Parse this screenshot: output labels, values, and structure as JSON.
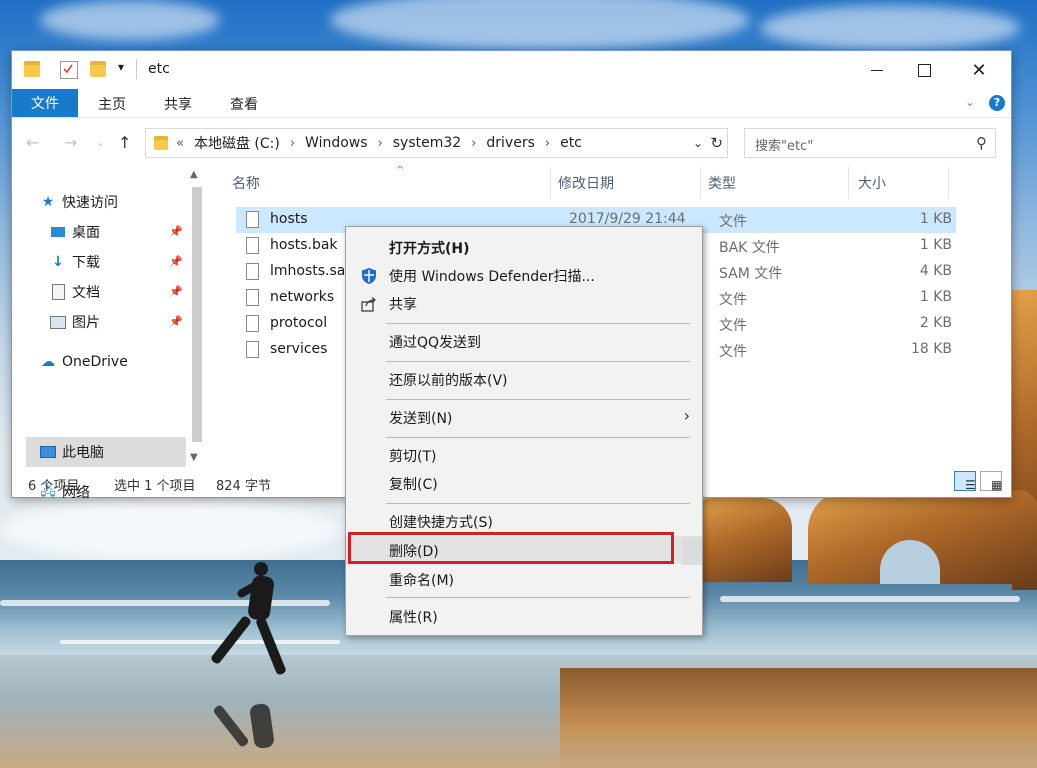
{
  "window": {
    "title": "etc",
    "qat_dropdown": "▾"
  },
  "ribbon": {
    "tabs": [
      {
        "label": "文件"
      },
      {
        "label": "主页"
      },
      {
        "label": "共享"
      },
      {
        "label": "查看"
      }
    ],
    "help": "?"
  },
  "address": {
    "path": [
      "本地磁盘 (C:)",
      "Windows",
      "system32",
      "drivers",
      "etc"
    ],
    "prefix": "«",
    "separator": "›"
  },
  "search": {
    "placeholder": "搜索\"etc\""
  },
  "nav": {
    "items": [
      {
        "label": "快速访问",
        "icon": "star-icon",
        "pinned": false
      },
      {
        "label": "桌面",
        "icon": "desktop-icon",
        "pinned": true
      },
      {
        "label": "下载",
        "icon": "download-icon",
        "pinned": true
      },
      {
        "label": "文档",
        "icon": "document-icon",
        "pinned": true
      },
      {
        "label": "图片",
        "icon": "picture-icon",
        "pinned": true
      },
      {
        "label": "OneDrive",
        "icon": "cloud-icon",
        "pinned": false
      },
      {
        "label": "此电脑",
        "icon": "computer-icon",
        "pinned": false,
        "selected": true
      },
      {
        "label": "网络",
        "icon": "network-icon",
        "pinned": false
      }
    ]
  },
  "columns": {
    "name": "名称",
    "date": "修改日期",
    "type": "类型",
    "size": "大小"
  },
  "files": [
    {
      "name": "hosts",
      "date": "2017/9/29 21:44",
      "type": "文件",
      "size": "1 KB",
      "selected": true
    },
    {
      "name": "hosts.bak",
      "date": "",
      "type": "BAK 文件",
      "size": "1 KB"
    },
    {
      "name": "lmhosts.sam",
      "date": "",
      "type": "SAM 文件",
      "size": "4 KB"
    },
    {
      "name": "networks",
      "date": "",
      "type": "文件",
      "size": "1 KB"
    },
    {
      "name": "protocol",
      "date": "",
      "type": "文件",
      "size": "2 KB"
    },
    {
      "name": "services",
      "date": "",
      "type": "文件",
      "size": "18 KB"
    }
  ],
  "status": {
    "count": "6 个项目",
    "selection": "选中 1 个项目",
    "size": "824 字节"
  },
  "context_menu": {
    "items": [
      {
        "label": "打开方式(H)",
        "bold": true
      },
      {
        "label": "使用 Windows Defender扫描...",
        "icon": "shield-icon"
      },
      {
        "label": "共享",
        "icon": "share-icon"
      },
      {
        "label": "通过QQ发送到"
      },
      {
        "label": "还原以前的版本(V)"
      },
      {
        "label": "发送到(N)",
        "submenu": true
      },
      {
        "label": "剪切(T)"
      },
      {
        "label": "复制(C)"
      },
      {
        "label": "创建快捷方式(S)"
      },
      {
        "label": "删除(D)",
        "highlighted": true
      },
      {
        "label": "重命名(M)"
      },
      {
        "label": "属性(R)"
      }
    ],
    "highlight_color": "#d0212a"
  },
  "colors": {
    "accent": "#1979ca",
    "selection": "#cce8ff"
  }
}
